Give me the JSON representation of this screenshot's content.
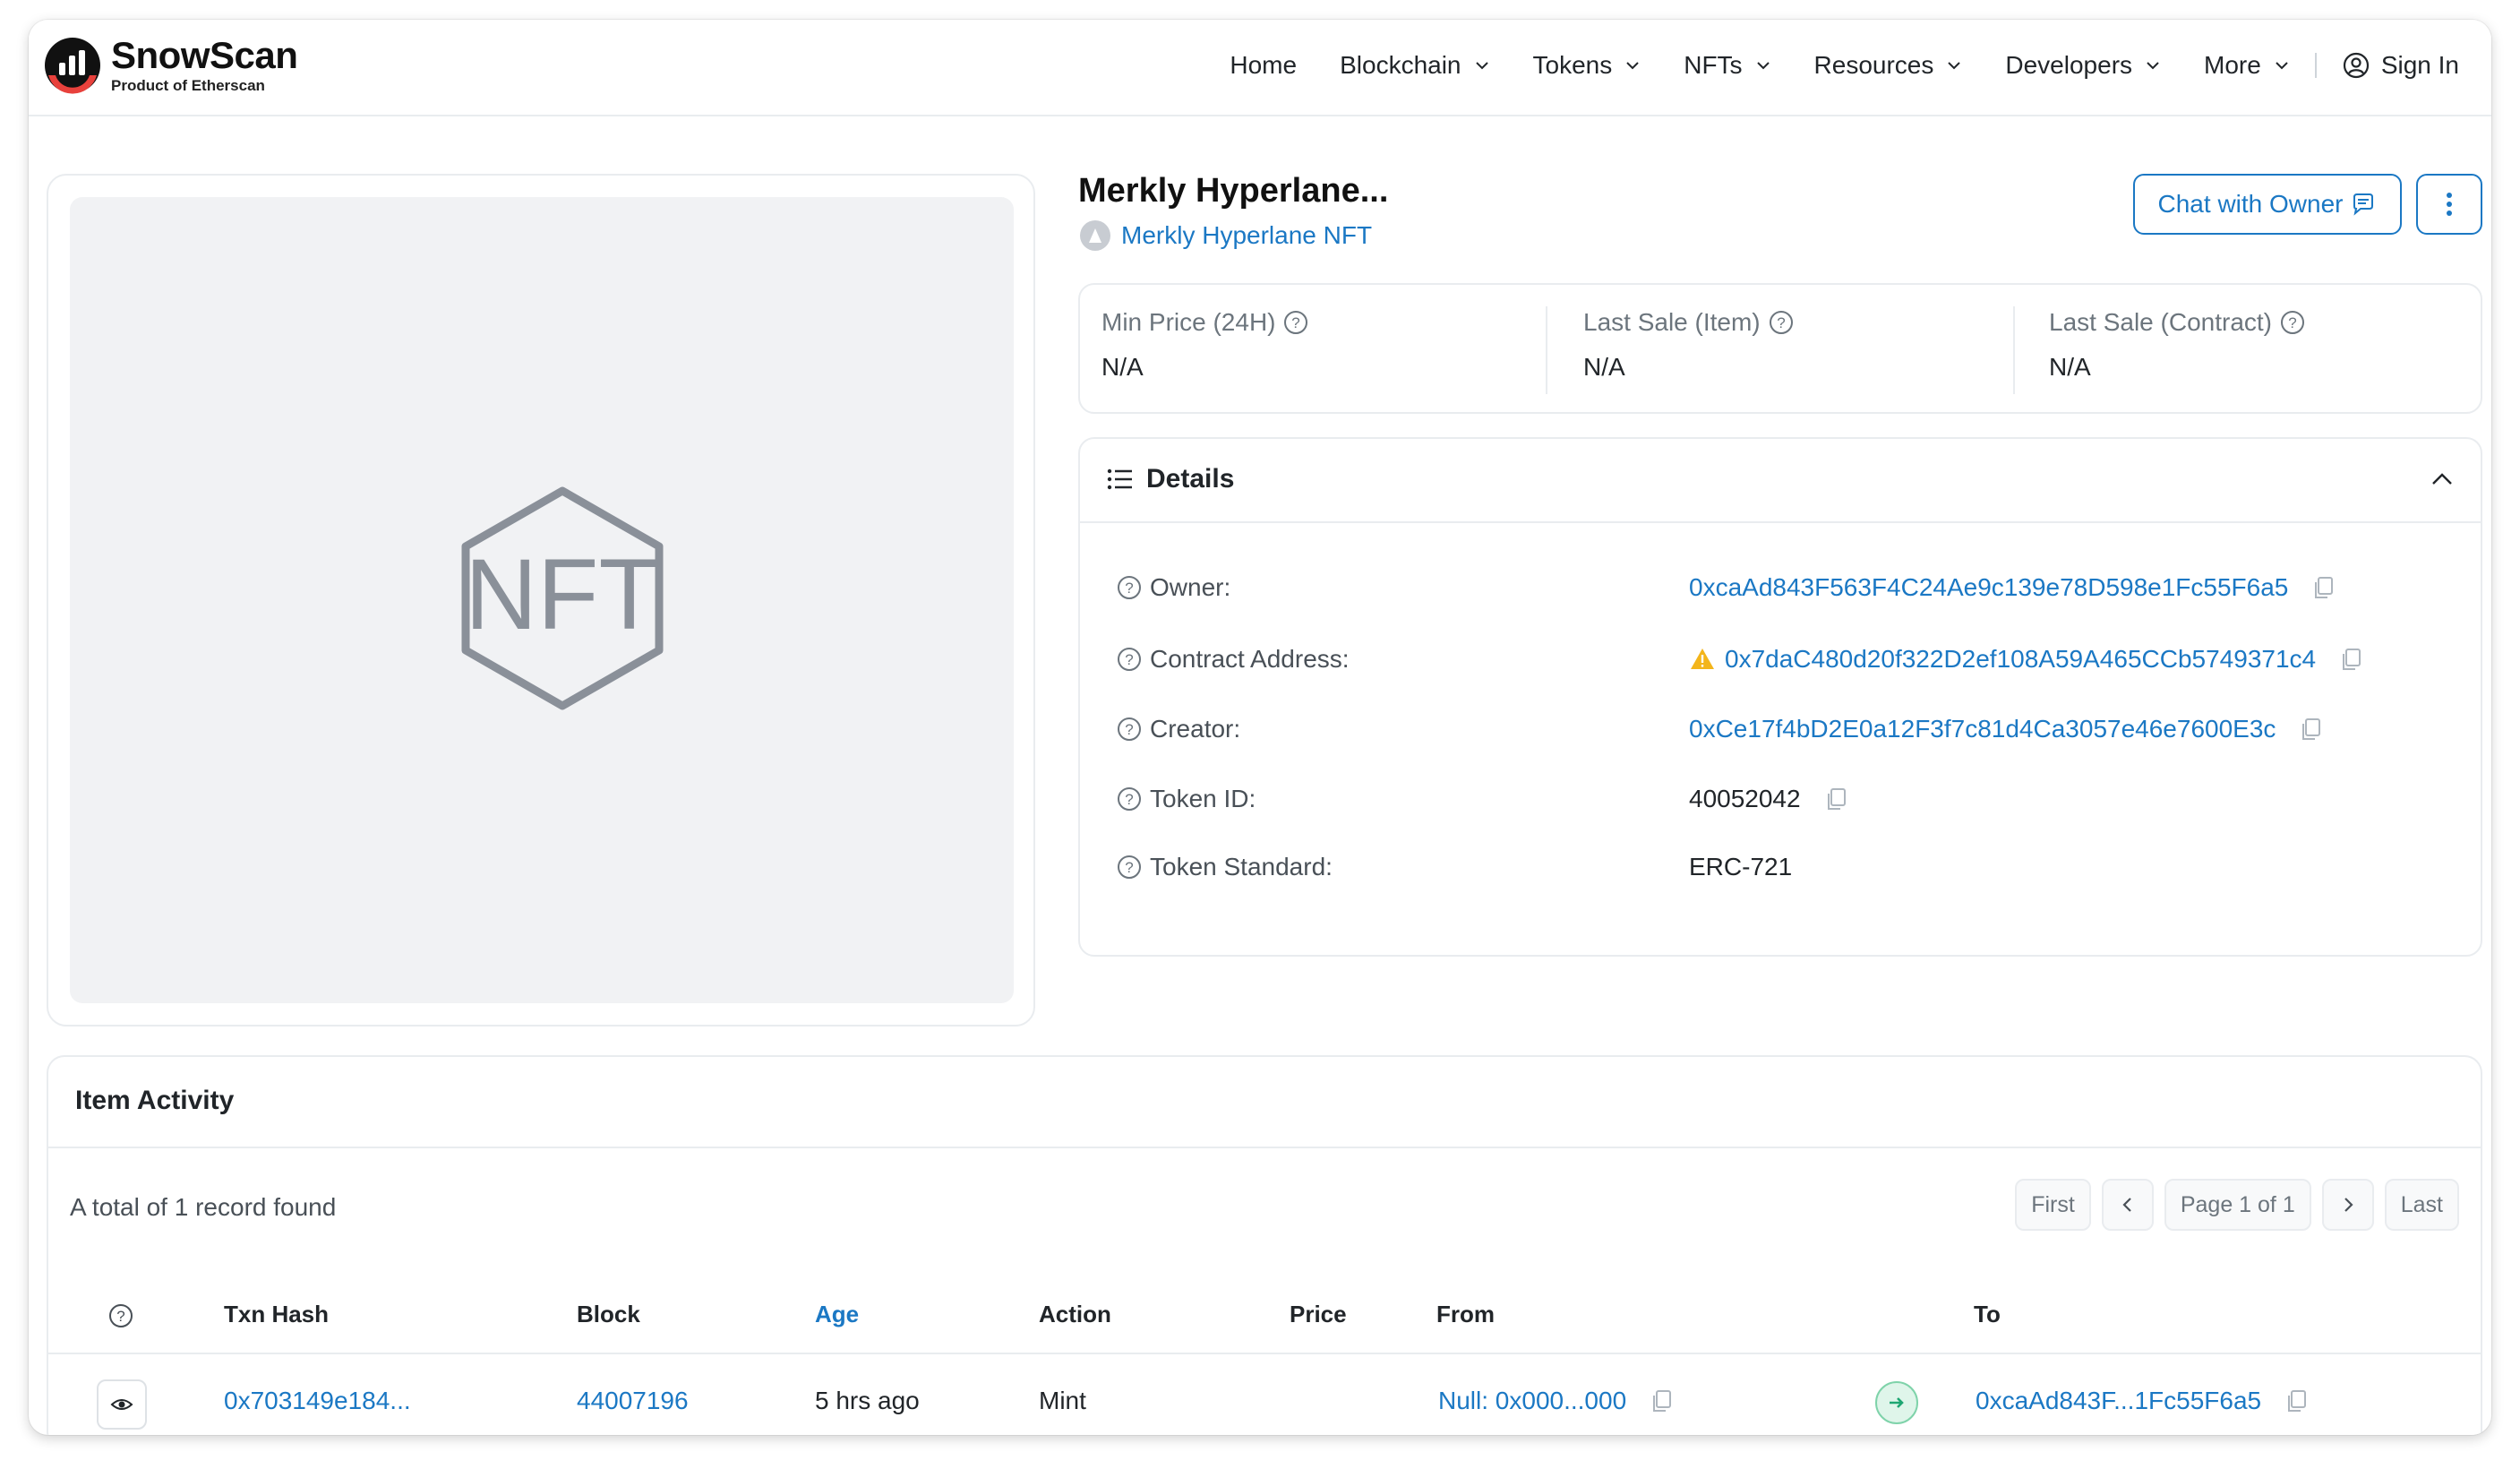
{
  "header": {
    "logo": {
      "name": "SnowScan",
      "sub": "Product of Etherscan"
    },
    "nav": [
      {
        "label": "Home",
        "dropdown": false
      },
      {
        "label": "Blockchain",
        "dropdown": true
      },
      {
        "label": "Tokens",
        "dropdown": true
      },
      {
        "label": "NFTs",
        "dropdown": true
      },
      {
        "label": "Resources",
        "dropdown": true
      },
      {
        "label": "Developers",
        "dropdown": true
      },
      {
        "label": "More",
        "dropdown": true
      }
    ],
    "sign_in": "Sign In"
  },
  "nft": {
    "title": "Merkly Hyperlane...",
    "collection": "Merkly Hyperlane NFT",
    "image_placeholder": "NFT"
  },
  "actions": {
    "chat_label": "Chat with Owner"
  },
  "prices": [
    {
      "label": "Min Price (24H)",
      "value": "N/A"
    },
    {
      "label": "Last Sale (Item)",
      "value": "N/A"
    },
    {
      "label": "Last Sale (Contract)",
      "value": "N/A"
    }
  ],
  "details": {
    "title": "Details",
    "rows": {
      "owner": {
        "label": "Owner:",
        "value": "0xcaAd843F563F4C24Ae9c139e78D598e1Fc55F6a5"
      },
      "contract": {
        "label": "Contract Address:",
        "value": "0x7daC480d20f322D2ef108A59A465CCb5749371c4"
      },
      "creator": {
        "label": "Creator:",
        "value": "0xCe17f4bD2E0a12F3f7c81d4Ca3057e46e7600E3c"
      },
      "token_id": {
        "label": "Token ID:",
        "value": "40052042"
      },
      "standard": {
        "label": "Token Standard:",
        "value": "ERC-721"
      }
    }
  },
  "activity": {
    "title": "Item Activity",
    "records": "A total of 1 record found",
    "pager": {
      "first": "First",
      "page": "Page 1 of 1",
      "last": "Last"
    },
    "columns": {
      "txn": "Txn Hash",
      "block": "Block",
      "age": "Age",
      "action": "Action",
      "price": "Price",
      "from": "From",
      "to": "To"
    },
    "row": {
      "txn": "0x703149e184...",
      "block": "44007196",
      "age": "5 hrs ago",
      "action": "Mint",
      "price": "",
      "from": "Null: 0x000...000",
      "to": "0xcaAd843F...1Fc55F6a5"
    }
  },
  "colors": {
    "link": "#1b78c4",
    "border": "#e9ecef",
    "muted": "#6c757d",
    "warning": "#f3b51b",
    "success": "#1ea672"
  }
}
